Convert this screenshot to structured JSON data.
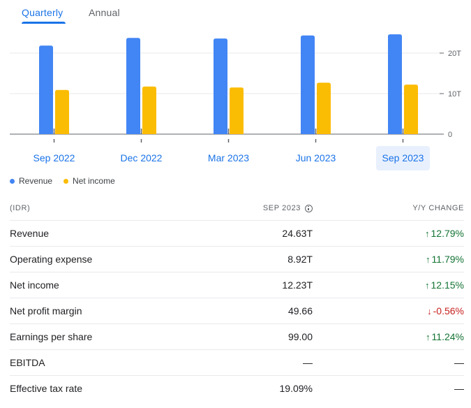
{
  "tabs": [
    {
      "label": "Quarterly",
      "active": true
    },
    {
      "label": "Annual",
      "active": false
    }
  ],
  "chart_data": {
    "type": "bar",
    "categories": [
      "Sep 2022",
      "Dec 2022",
      "Mar 2023",
      "Jun 2023",
      "Sep 2023"
    ],
    "series": [
      {
        "name": "Revenue",
        "color": "#4285f4",
        "values": [
          21.85,
          23.75,
          23.6,
          24.35,
          24.63
        ]
      },
      {
        "name": "Net income",
        "color": "#fbbc04",
        "values": [
          10.9,
          11.75,
          11.5,
          12.7,
          12.23
        ]
      }
    ],
    "yticks": [
      "0",
      "10T",
      "20T"
    ],
    "ytick_values": [
      0,
      10,
      20
    ],
    "ylim": [
      0,
      25
    ],
    "grid": true,
    "selected_category": "Sep 2023"
  },
  "legend": [
    {
      "name": "Revenue",
      "color": "#4285f4"
    },
    {
      "name": "Net income",
      "color": "#fbbc04"
    }
  ],
  "table": {
    "header": {
      "currency": "(IDR)",
      "period": "SEP 2023",
      "change": "Y/Y CHANGE"
    },
    "rows": [
      {
        "label": "Revenue",
        "value": "24.63T",
        "change": "12.79%",
        "dir": "up"
      },
      {
        "label": "Operating expense",
        "value": "8.92T",
        "change": "11.79%",
        "dir": "up"
      },
      {
        "label": "Net income",
        "value": "12.23T",
        "change": "12.15%",
        "dir": "up"
      },
      {
        "label": "Net profit margin",
        "value": "49.66",
        "change": "-0.56%",
        "dir": "down"
      },
      {
        "label": "Earnings per share",
        "value": "99.00",
        "change": "11.24%",
        "dir": "up"
      },
      {
        "label": "EBITDA",
        "value": "—",
        "change": "—",
        "dir": "none"
      },
      {
        "label": "Effective tax rate",
        "value": "19.09%",
        "change": "—",
        "dir": "none"
      }
    ]
  }
}
